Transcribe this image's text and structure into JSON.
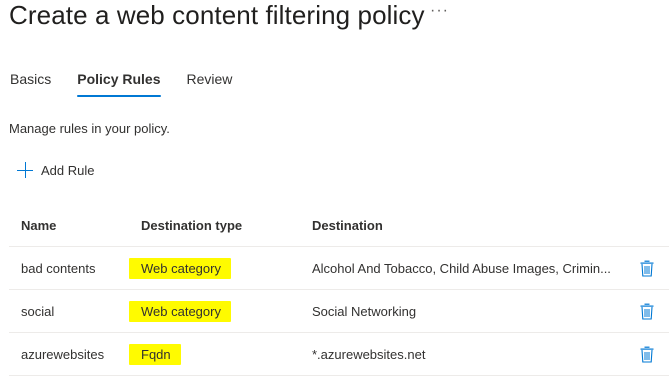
{
  "page": {
    "title": "Create a web content filtering policy",
    "more_label": "···"
  },
  "tabs": [
    {
      "label": "Basics",
      "active": false
    },
    {
      "label": "Policy Rules",
      "active": true
    },
    {
      "label": "Review",
      "active": false
    }
  ],
  "description": "Manage rules in your policy.",
  "toolbar": {
    "add_rule_label": "Add Rule",
    "add_rule_icon": "plus-icon"
  },
  "table": {
    "columns": [
      "Name",
      "Destination type",
      "Destination"
    ],
    "rows": [
      {
        "name": "bad contents",
        "destination_type": "Web category",
        "destination": "Alcohol And Tobacco, Child Abuse Images, Crimin...",
        "delete_icon": "trash-icon"
      },
      {
        "name": "social",
        "destination_type": "Web category",
        "destination": "Social Networking",
        "delete_icon": "trash-icon"
      },
      {
        "name": "azurewebsites",
        "destination_type": "Fqdn",
        "destination": "*.azurewebsites.net",
        "delete_icon": "trash-icon"
      }
    ]
  },
  "colors": {
    "accent": "#0078d4",
    "highlight": "#fffb00",
    "text": "#323130",
    "divider": "#edebe9"
  }
}
